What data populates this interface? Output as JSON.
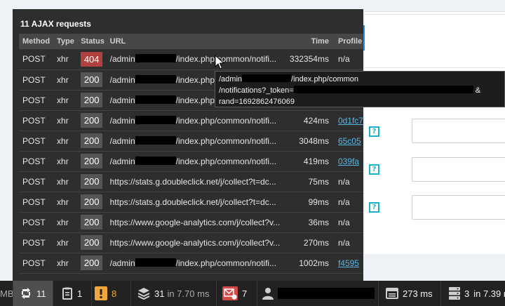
{
  "ajax_panel": {
    "title": "11 AJAX requests",
    "columns": [
      "Method",
      "Type",
      "Status",
      "URL",
      "Time",
      "Profile"
    ],
    "rows": [
      {
        "method": "POST",
        "type": "xhr",
        "status": "404",
        "url_a": "/admin",
        "url_b": "/index.php/common/notifi...",
        "time": "332354ms",
        "profile": "n/a",
        "redacted": true,
        "status_error": true,
        "profile_link": false
      },
      {
        "method": "POST",
        "type": "xhr",
        "status": "200",
        "url_a": "/admin",
        "url_b": "/index.php/common/notifi...",
        "time": "",
        "profile": "",
        "redacted": true,
        "status_error": false,
        "profile_link": false
      },
      {
        "method": "POST",
        "type": "xhr",
        "status": "200",
        "url_a": "/admin",
        "url_b": "/index.php/common/notifi...",
        "time": "",
        "profile": "",
        "redacted": true,
        "status_error": false,
        "profile_link": false
      },
      {
        "method": "POST",
        "type": "xhr",
        "status": "200",
        "url_a": "/admin",
        "url_b": "/index.php/common/notifi...",
        "time": "424ms",
        "profile": "0d1fc7",
        "redacted": true,
        "status_error": false,
        "profile_link": true
      },
      {
        "method": "POST",
        "type": "xhr",
        "status": "200",
        "url_a": "/admin",
        "url_b": "/index.php/common/notifi...",
        "time": "3048ms",
        "profile": "65c05",
        "redacted": true,
        "status_error": false,
        "profile_link": true
      },
      {
        "method": "POST",
        "type": "xhr",
        "status": "200",
        "url_a": "/admin",
        "url_b": "/index.php/common/notifi...",
        "time": "419ms",
        "profile": "039fa",
        "redacted": true,
        "status_error": false,
        "profile_link": true
      },
      {
        "method": "POST",
        "type": "xhr",
        "status": "200",
        "url_a": "https://stats.g.doubleclick.net/j/collect?t=dc...",
        "url_b": "",
        "time": "75ms",
        "profile": "n/a",
        "redacted": false,
        "status_error": false,
        "profile_link": false
      },
      {
        "method": "POST",
        "type": "xhr",
        "status": "200",
        "url_a": "https://stats.g.doubleclick.net/j/collect?t=dc...",
        "url_b": "",
        "time": "99ms",
        "profile": "n/a",
        "redacted": false,
        "status_error": false,
        "profile_link": false
      },
      {
        "method": "POST",
        "type": "xhr",
        "status": "200",
        "url_a": "https://www.google-analytics.com/j/collect?v...",
        "url_b": "",
        "time": "36ms",
        "profile": "n/a",
        "redacted": false,
        "status_error": false,
        "profile_link": false
      },
      {
        "method": "POST",
        "type": "xhr",
        "status": "200",
        "url_a": "https://www.google-analytics.com/j/collect?v...",
        "url_b": "",
        "time": "270ms",
        "profile": "n/a",
        "redacted": false,
        "status_error": false,
        "profile_link": false
      },
      {
        "method": "POST",
        "type": "xhr",
        "status": "200",
        "url_a": "/admin",
        "url_b": "/index.php/common/notifi...",
        "time": "1002ms",
        "profile": "f4595",
        "redacted": true,
        "status_error": false,
        "profile_link": true
      }
    ]
  },
  "tooltip": {
    "line1_a": "/admin",
    "line1_b": "/index.php/common",
    "line2_a": "/notifications?_token=",
    "line2_b": "&",
    "line3": "rand=1692862476069"
  },
  "toolbar": {
    "memory_suffix": "MB",
    "ajax_count": "11",
    "forms_count": "1",
    "warnings_count": "8",
    "queries_count": "31",
    "queries_time": "in 7.70 ms",
    "errors_count": "7",
    "time": "273 ms",
    "cache_count": "3",
    "cache_time": "in 7.39 m"
  },
  "colors": {
    "panel_bg": "#2e2e2e",
    "status_error": "#b0413e",
    "status_ok": "#555555",
    "link": "#56b8e6",
    "warning": "#f0a63a",
    "help_icon": "#1ab2c8"
  },
  "icons": [
    "cursor-arrow-icon",
    "ajax-sync-icon",
    "form-icon",
    "warning-icon",
    "database-layers-icon",
    "mail-error-icon",
    "user-icon",
    "time-panel-icon",
    "server-stack-icon",
    "help-icon"
  ]
}
